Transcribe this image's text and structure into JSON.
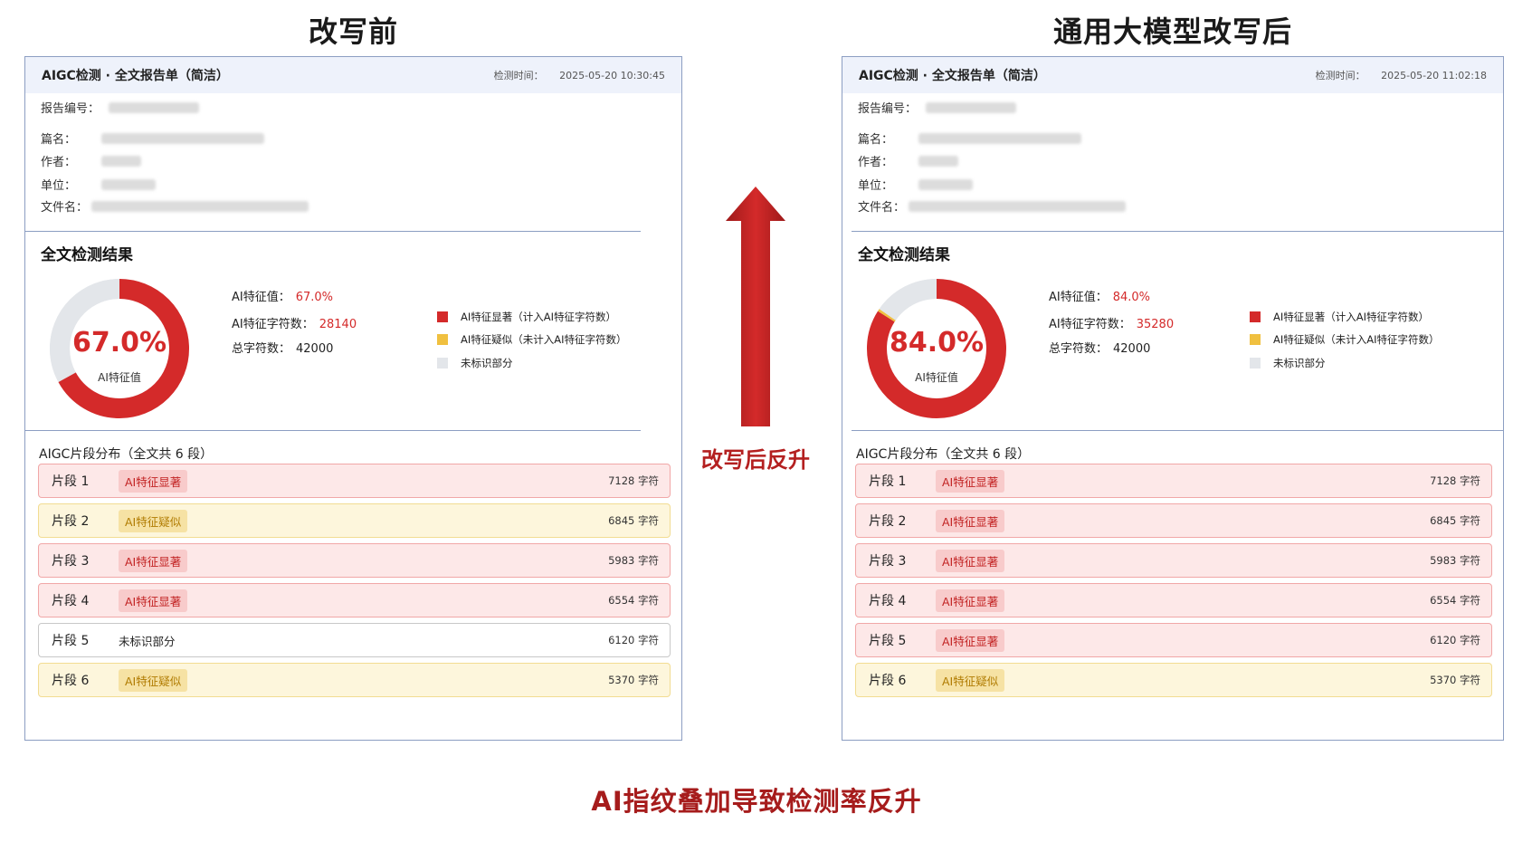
{
  "headings": {
    "before": "改写前",
    "after": "通用大模型改写后"
  },
  "arrow_caption": "改写后反升",
  "bottom_caption": "AI指纹叠加导致检测率反升",
  "colors": {
    "significant": "#d42a2a",
    "suspected": "#f0c040",
    "unmarked": "#e3e6ea",
    "panel_border": "#8c9ec2",
    "accent": "#b42020"
  },
  "labels": {
    "report_title": "AIGC检测 · 全文报告单（简洁）",
    "time_label": "检测时间：",
    "report_no": "报告编号：",
    "title_field": "篇名：",
    "author_field": "作者：",
    "unit_field": "单位：",
    "filename_field": "文件名：",
    "result_title": "全文检测结果",
    "donut_sub": "AI特征值",
    "ai_value": "AI特征值：",
    "ai_chars": "AI特征字符数：",
    "total_chars": "总字符数：",
    "legend": {
      "significant": "AI特征显著（计入AI特征字符数）",
      "suspected": "AI特征疑似（未计入AI特征字符数）",
      "unmarked": "未标识部分"
    },
    "segments_title": "AIGC片段分布（全文共 6 段）",
    "tag_significant": "AI特征显著",
    "tag_suspected": "AI特征疑似",
    "tag_unmarked": "未标识部分"
  },
  "before": {
    "time": "2025-05-20  10:30:45",
    "ai_value": "67.0%",
    "ai_chars": "28140",
    "total_chars": "42000",
    "segments": [
      {
        "name": "片段 1",
        "status": "significant",
        "tag": "AI特征显著",
        "count": "7128 字符"
      },
      {
        "name": "片段 2",
        "status": "suspected",
        "tag": "AI特征疑似",
        "count": "6845 字符"
      },
      {
        "name": "片段 3",
        "status": "significant",
        "tag": "AI特征显著",
        "count": "5983 字符"
      },
      {
        "name": "片段 4",
        "status": "significant",
        "tag": "AI特征显著",
        "count": "6554 字符"
      },
      {
        "name": "片段 5",
        "status": "unmarked",
        "tag": "未标识部分",
        "count": "6120 字符"
      },
      {
        "name": "片段 6",
        "status": "suspected",
        "tag": "AI特征疑似",
        "count": "5370 字符"
      }
    ]
  },
  "after": {
    "time": "2025-05-20  11:02:18",
    "ai_value": "84.0%",
    "ai_chars": "35280",
    "total_chars": "42000",
    "segments": [
      {
        "name": "片段 1",
        "status": "significant",
        "tag": "AI特征显著",
        "count": "7128 字符"
      },
      {
        "name": "片段 2",
        "status": "significant",
        "tag": "AI特征显著",
        "count": "6845 字符"
      },
      {
        "name": "片段 3",
        "status": "significant",
        "tag": "AI特征显著",
        "count": "5983 字符"
      },
      {
        "name": "片段 4",
        "status": "significant",
        "tag": "AI特征显著",
        "count": "6554 字符"
      },
      {
        "name": "片段 5",
        "status": "significant",
        "tag": "AI特征显著",
        "count": "6120 字符"
      },
      {
        "name": "片段 6",
        "status": "suspected",
        "tag": "AI特征疑似",
        "count": "5370 字符"
      }
    ]
  },
  "chart_data": [
    {
      "type": "pie",
      "categories": [
        "AI特征显著",
        "AI特征疑似",
        "未标识部分"
      ],
      "values": [
        67.0,
        0,
        33.0
      ]
    },
    {
      "type": "pie",
      "categories": [
        "AI特征显著",
        "AI特征疑似",
        "未标识部分"
      ],
      "values": [
        84.0,
        0.6,
        15.4
      ]
    }
  ]
}
